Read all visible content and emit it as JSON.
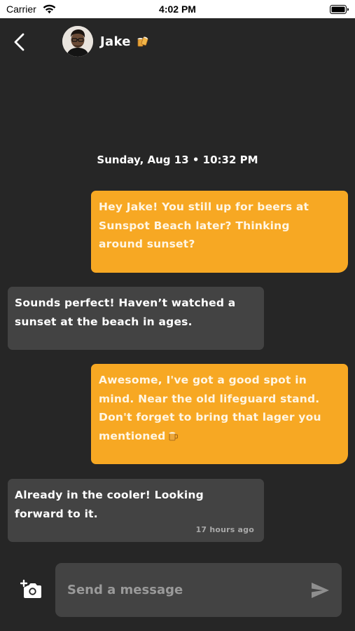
{
  "status_bar": {
    "carrier": "Carrier",
    "time": "4:02 PM",
    "wifi_icon": "wifi-icon",
    "battery_icon": "battery-icon"
  },
  "header": {
    "back_icon": "chevron-left-icon",
    "contact_name": "Jake",
    "contact_emoji_icon": "beer-mugs-icon"
  },
  "conversation": {
    "date_stamp": "Sunday, Aug 13 • 10:32 PM",
    "messages": [
      {
        "direction": "sent",
        "text": "Hey Jake! You still up for beers at Sunspot Beach later? Thinking around sunset?"
      },
      {
        "direction": "received",
        "text": "Sounds perfect! Haven’t watched a sunset at the beach in ages."
      },
      {
        "direction": "sent",
        "text": "Awesome, I've got a good spot in mind. Near the old lifeguard stand. Don't forget to bring that lager you mentioned",
        "trailing_icon": "beer-mug-icon"
      },
      {
        "direction": "received",
        "text": "Already in the cooler! Looking forward to it.",
        "time": "17 hours ago"
      }
    ]
  },
  "composer": {
    "camera_icon": "add-photo-icon",
    "placeholder": "Send a message",
    "value": "",
    "send_icon": "send-icon"
  },
  "colors": {
    "background": "#262626",
    "sent_bubble": "#f7a823",
    "received_bubble": "#434343",
    "input_background": "#434343"
  }
}
